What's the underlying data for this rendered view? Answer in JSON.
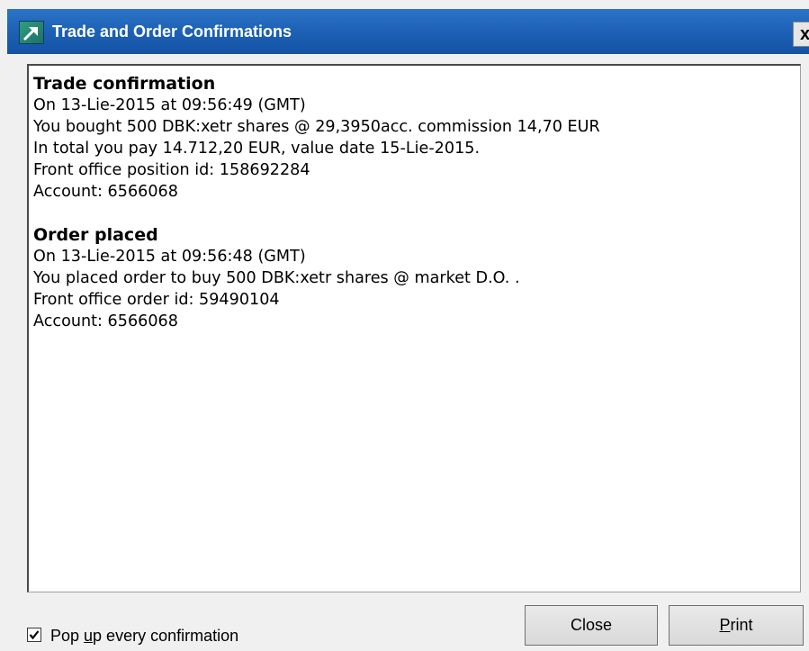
{
  "window": {
    "title": "Trade and Order Confirmations",
    "close_glyph": "x"
  },
  "trade": {
    "heading": "Trade confirmation",
    "lines": [
      "On 13-Lie-2015 at 09:56:49 (GMT)",
      "You bought 500 DBK:xetr shares @ 29,3950acc. commission 14,70 EUR",
      "In total you pay 14.712,20 EUR, value date 15-Lie-2015.",
      "Front office position id: 158692284",
      "Account: 6566068"
    ]
  },
  "order": {
    "heading": "Order placed",
    "lines": [
      "On 13-Lie-2015 at 09:56:48 (GMT)",
      "You placed order to buy 500 DBK:xetr shares @ market D.O. .",
      "Front office order id: 59490104",
      "Account: 6566068"
    ]
  },
  "footer": {
    "checkbox_checked": true,
    "checkbox_label_pre": "Pop ",
    "checkbox_label_accel": "u",
    "checkbox_label_post": "p every confirmation",
    "close_label": "Close",
    "print_label_accel": "P",
    "print_label_rest": "rint"
  },
  "icons": {
    "app": "arrow-up-right-icon",
    "close": "close-icon",
    "check": "checkmark-icon"
  }
}
